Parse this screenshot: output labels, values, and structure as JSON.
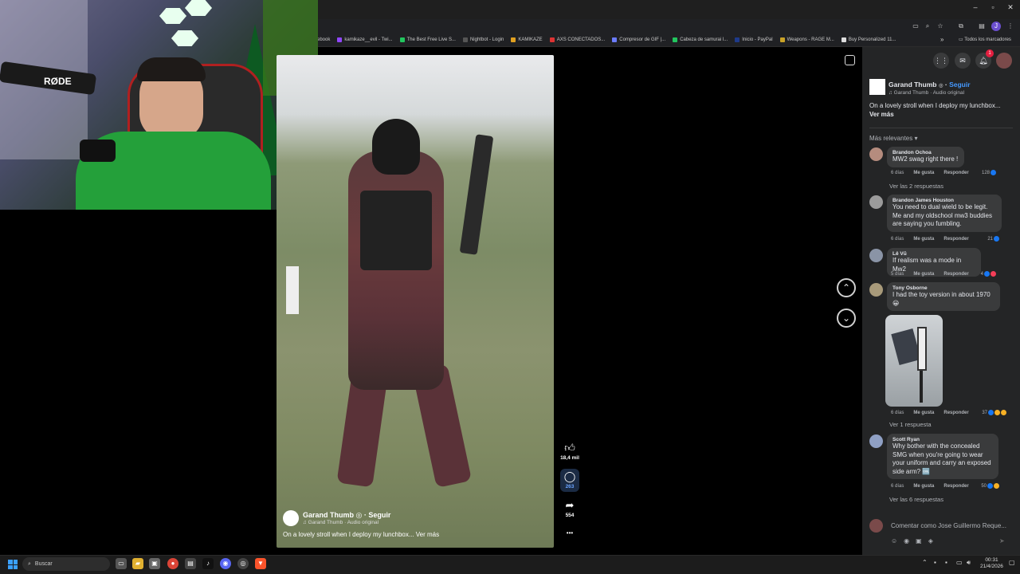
{
  "browser": {
    "window_controls": [
      "–",
      "▫",
      "✕"
    ],
    "bookmarks": [
      {
        "label": "ebook",
        "color": "#3b5998"
      },
      {
        "label": "kamikaze__evil - Twi...",
        "color": "#9146ff"
      },
      {
        "label": "The Best Free Live S...",
        "color": "#22c55e"
      },
      {
        "label": "Nightbot - Login",
        "color": "#555555"
      },
      {
        "label": "KAMIKAZE",
        "color": "#e0a020"
      },
      {
        "label": "AXS CONECTADOS...",
        "color": "#d33"
      },
      {
        "label": "Compresor de GIF |...",
        "color": "#6b7cff"
      },
      {
        "label": "Cabeza de samurai l...",
        "color": "#22c55e"
      },
      {
        "label": "Inicio - PayPal",
        "color": "#1e3a8a"
      },
      {
        "label": "Weapons - RAGE M...",
        "color": "#c9a227"
      },
      {
        "label": "Buy Personalized 11...",
        "color": "#dddddd"
      }
    ],
    "all_bookmarks": "Todos los marcadores",
    "more": "»"
  },
  "webcam": {
    "mic_brand": "RØDE"
  },
  "video": {
    "author": "Garand Thumb",
    "follow": "Seguir",
    "audio": "♫ Garand Thumb · Audio original",
    "caption": "On a lovely stroll when I deploy my lunchbox... Ver más",
    "actions": {
      "likes": "18,4 mil",
      "comments": "263",
      "shares": "554",
      "more": "•••"
    }
  },
  "panel": {
    "header_icons": [
      "grid-icon",
      "messenger-icon",
      "bell-icon",
      "profile-avatar"
    ],
    "notif_count": "1",
    "author": "Garand Thumb",
    "follow": "Seguir",
    "audio": "♫ Garand Thumb · Audio original",
    "caption": "On a lovely stroll when I deploy my lunchbox...",
    "see_more": "Ver más",
    "sort": "Más relevantes",
    "comments": [
      {
        "name": "Brandon Ochoa",
        "text": "MW2 swag right there !",
        "time": "6 días",
        "like": "Me gusta",
        "reply": "Responder",
        "count": "128",
        "replies": "Ver las 2 respuestas"
      },
      {
        "name": "Brandon James Houston",
        "text": "You need to dual wield to be legit. Me and my oldschool mw3 buddies are saying you fumbling.",
        "time": "6 días",
        "like": "Me gusta",
        "reply": "Responder",
        "count": "21"
      },
      {
        "name": "Lê Vũ",
        "text": "If realism was a mode in Mw2",
        "time": "5 días",
        "like": "Me gusta",
        "reply": "Responder",
        "count": "4"
      },
      {
        "name": "Tony Osborne",
        "text": "I had the toy version in about 1970 😀",
        "time": "6 días",
        "like": "Me gusta",
        "reply": "Responder",
        "count": "37",
        "replies": "Ver 1 respuesta"
      },
      {
        "name": "Scott Ryan",
        "text": "Why bother with the concealed SMG when you're going to wear your uniform and carry an exposed side arm? 🆒",
        "time": "6 días",
        "like": "Me gusta",
        "reply": "Responder",
        "count": "50",
        "replies": "Ver las 6 respuestas"
      }
    ],
    "compose_placeholder": "Comentar como Jose Guillermo Reque..."
  },
  "taskbar": {
    "search": "Buscar",
    "time": "00:31",
    "date": "21/4/2026"
  }
}
